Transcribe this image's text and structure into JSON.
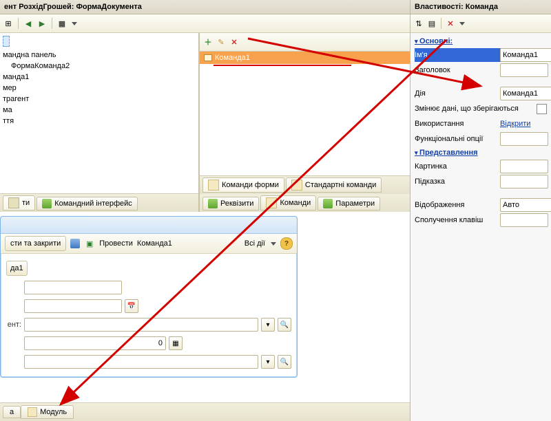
{
  "left": {
    "title": "ент РозхідГрошей: ФормаДокумента",
    "tree": [
      "мандна панель",
      "ФормаКоманда2",
      "манда1",
      "мер",
      "трагент",
      "ма",
      "ття"
    ],
    "lower_tabs": [
      "ти",
      "Командний інтерфейс"
    ],
    "cmd": {
      "selected": "Команда1",
      "tabs": [
        "Команди форми",
        "Стандартні команди"
      ],
      "lower_tabs": [
        "Реквізити",
        "Команди",
        "Параметри"
      ]
    },
    "preview": {
      "btn_save_close": "сти та закрити",
      "btn_conduct": "Провести",
      "cmd1": "Команда1",
      "all_actions": "Всі дії",
      "crumb": "да1",
      "lbl_ent": "ент:",
      "val_zero": "0"
    },
    "bottom_tabs": [
      "а",
      "Модуль"
    ]
  },
  "props": {
    "title": "Властивості: Команда",
    "g1": "Основні:",
    "name_lbl": "Ім'я",
    "name_val": "Команда1",
    "title_lbl": "Заголовок",
    "action_lbl": "Дія",
    "action_val": "Команда1",
    "changes_lbl": "Змінює дані, що зберігаються",
    "usage_lbl": "Використання",
    "usage_val": "Відкрити",
    "funcopts_lbl": "Функціональні опції",
    "g2": "Представлення",
    "picture_lbl": "Картинка",
    "hint_lbl": "Підказка",
    "display_lbl": "Відображення",
    "display_val": "Авто",
    "shortcut_lbl": "Сполучення клавіш"
  }
}
